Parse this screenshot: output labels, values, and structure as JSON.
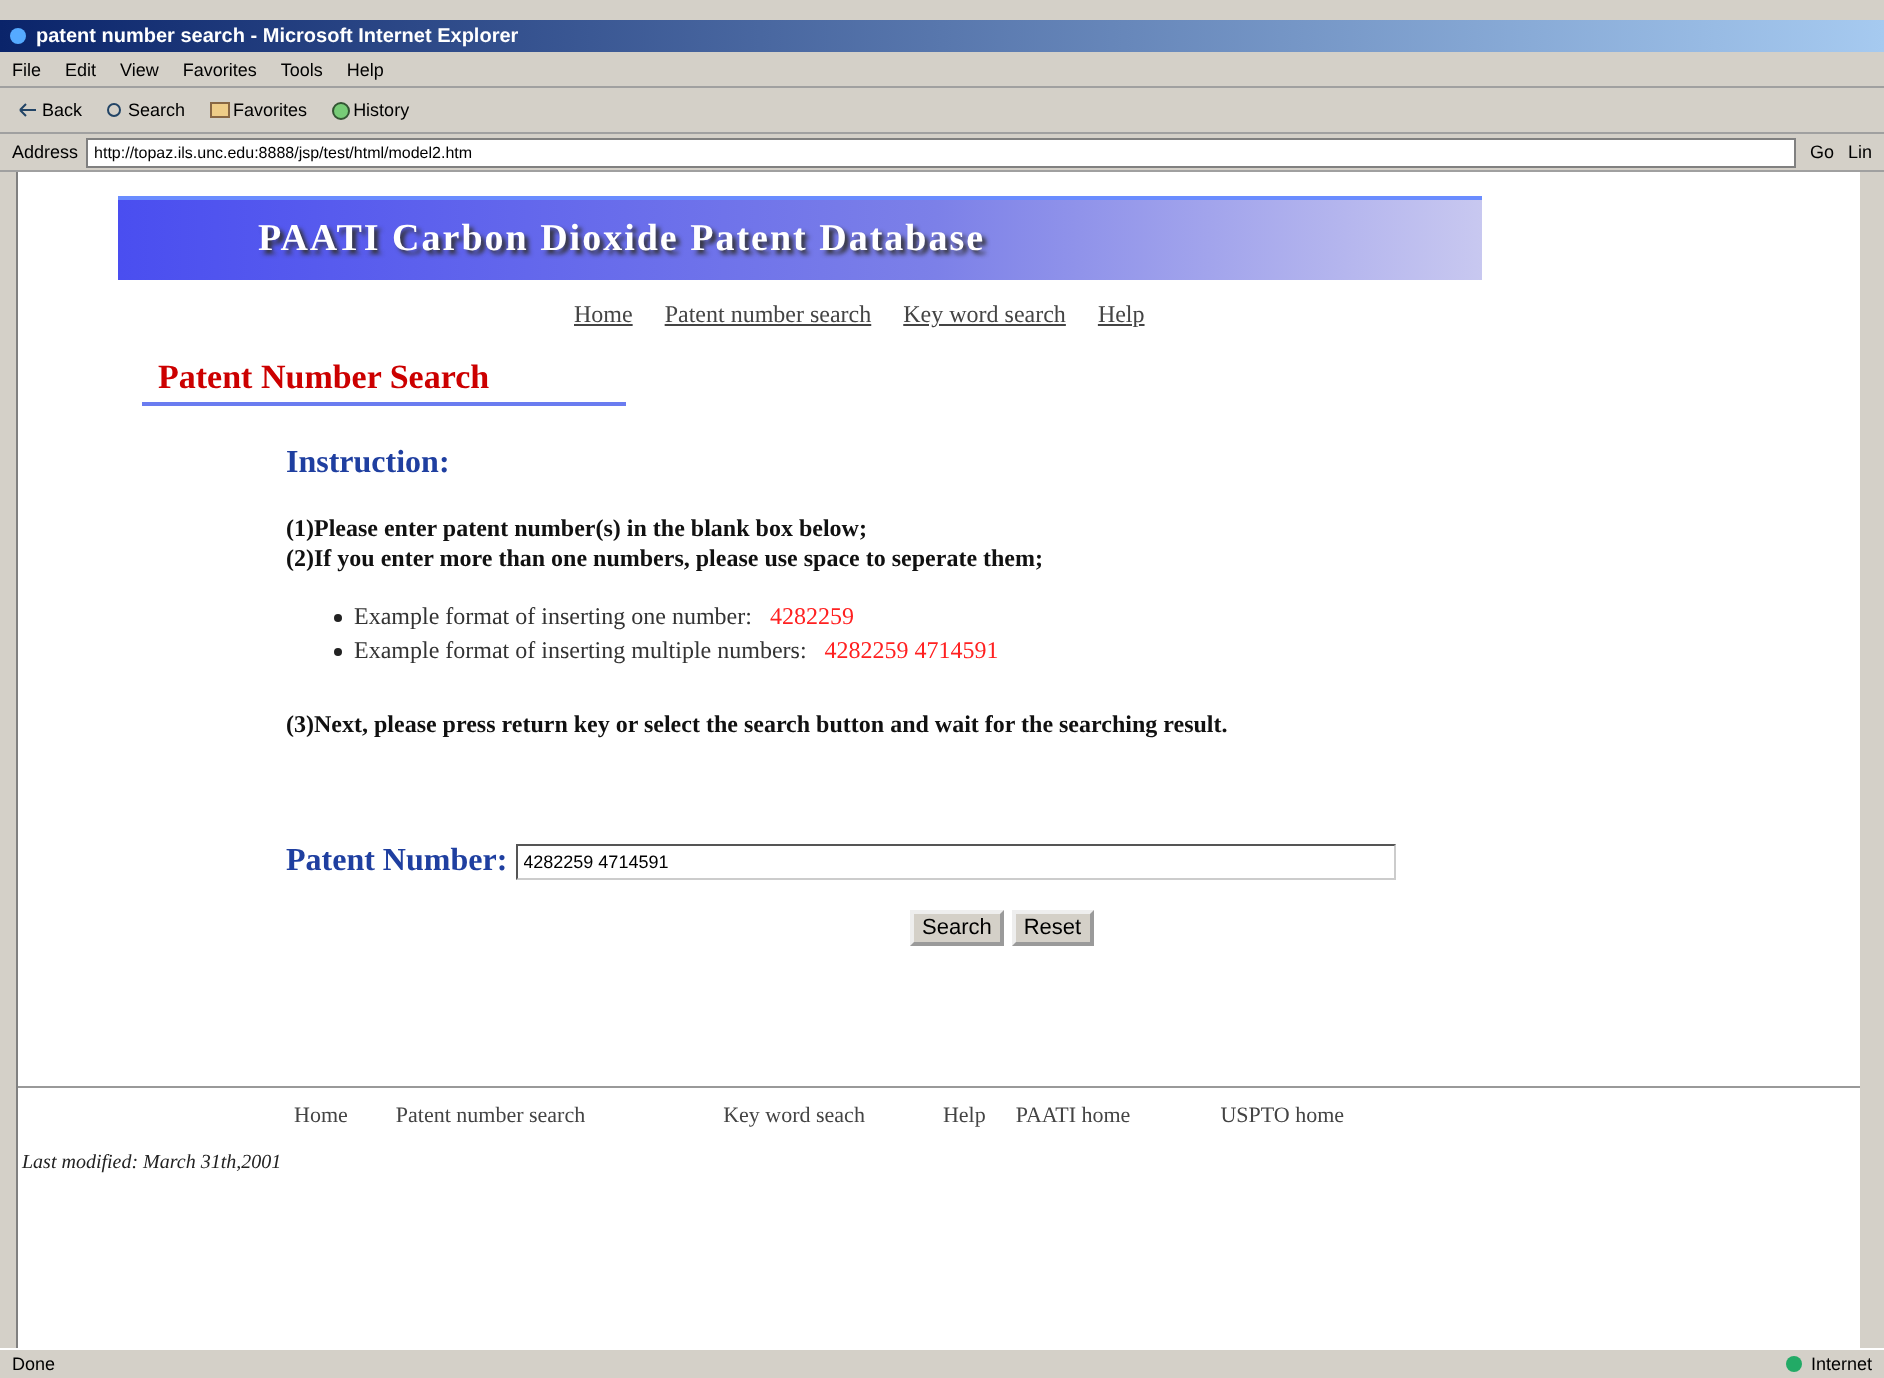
{
  "window": {
    "title": "patent number search - Microsoft Internet Explorer"
  },
  "menu": [
    "File",
    "Edit",
    "View",
    "Favorites",
    "Tools",
    "Help"
  ],
  "toolbar": [
    {
      "kind": "back",
      "label": "Back"
    },
    {
      "kind": "search",
      "label": "Search"
    },
    {
      "kind": "favorites",
      "label": "Favorites"
    },
    {
      "kind": "history",
      "label": "History"
    }
  ],
  "address_bar": {
    "label": "Address",
    "url": "http://topaz.ils.unc.edu:8888/jsp/test/html/model2.htm",
    "go": "Go",
    "links": "Lin"
  },
  "banner": {
    "title": "PAATI Carbon Dioxide Patent Database"
  },
  "nav": [
    "Home",
    "Patent number search",
    "Key word search",
    "Help"
  ],
  "page_heading": "Patent Number Search",
  "instruction": {
    "heading": "Instruction:",
    "steps": [
      "(1)Please enter patent number(s) in the blank box below;",
      "(2)If you enter more than one numbers, please use space to seperate them;"
    ],
    "examples": [
      {
        "text": "Example format of inserting one number: ",
        "value": "4282259"
      },
      {
        "text": "Example format of inserting multiple numbers: ",
        "value": "4282259 4714591"
      }
    ],
    "final_step": "(3)Next, please press return key or select the search button and wait for the searching result."
  },
  "form": {
    "label": "Patent Number:",
    "value": "4282259 4714591",
    "buttons": [
      "Search",
      "Reset"
    ]
  },
  "footer": {
    "links": [
      "Home",
      "Patent number search",
      "Key word seach",
      "Help",
      "PAATI home",
      "USPTO home"
    ],
    "last_modified": "Last modified: March 31th,2001"
  },
  "status_bar": {
    "text": "Done",
    "zone": "Internet"
  }
}
